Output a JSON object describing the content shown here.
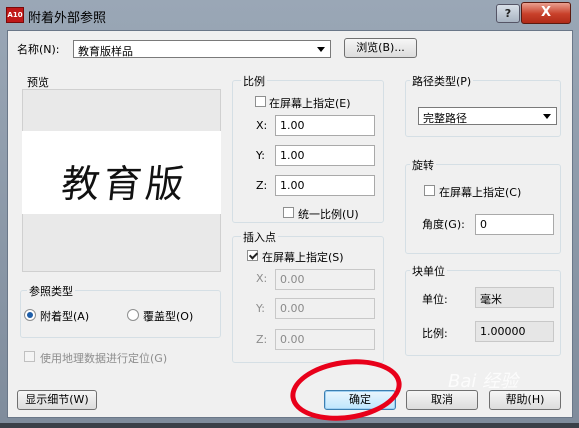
{
  "window": {
    "title": "附着外部参照",
    "app_icon_text": "A10",
    "help_glyph": "?",
    "close_glyph": "X"
  },
  "name_row": {
    "label": "名称(N):",
    "value": "教育版样品",
    "browse_label": "浏览(B)..."
  },
  "preview": {
    "label": "预览",
    "image_text": "教育版"
  },
  "ref_type": {
    "legend": "参照类型",
    "attach_label": "附着型(A)",
    "overlay_label": "覆盖型(O)"
  },
  "geo": {
    "label": "使用地理数据进行定位(G)"
  },
  "scale": {
    "legend": "比例",
    "specify_label": "在屏幕上指定(E)",
    "x_label": "X:",
    "x_value": "1.00",
    "y_label": "Y:",
    "y_value": "1.00",
    "z_label": "Z:",
    "z_value": "1.00",
    "uniform_label": "统一比例(U)"
  },
  "insert": {
    "legend": "插入点",
    "specify_label": "在屏幕上指定(S)",
    "x_label": "X:",
    "x_value": "0.00",
    "y_label": "Y:",
    "y_value": "0.00",
    "z_label": "Z:",
    "z_value": "0.00"
  },
  "path_type": {
    "legend": "路径类型(P)",
    "value": "完整路径"
  },
  "rotation": {
    "legend": "旋转",
    "specify_label": "在屏幕上指定(C)",
    "angle_label": "角度(G):",
    "angle_value": "0"
  },
  "block_unit": {
    "legend": "块单位",
    "unit_label": "单位:",
    "unit_value": "毫米",
    "ratio_label": "比例:",
    "ratio_value": "1.00000"
  },
  "buttons": {
    "details": "显示细节(W)",
    "ok": "确定",
    "cancel": "取消",
    "help": "帮助(H)"
  },
  "watermark": "Bai 经验"
}
